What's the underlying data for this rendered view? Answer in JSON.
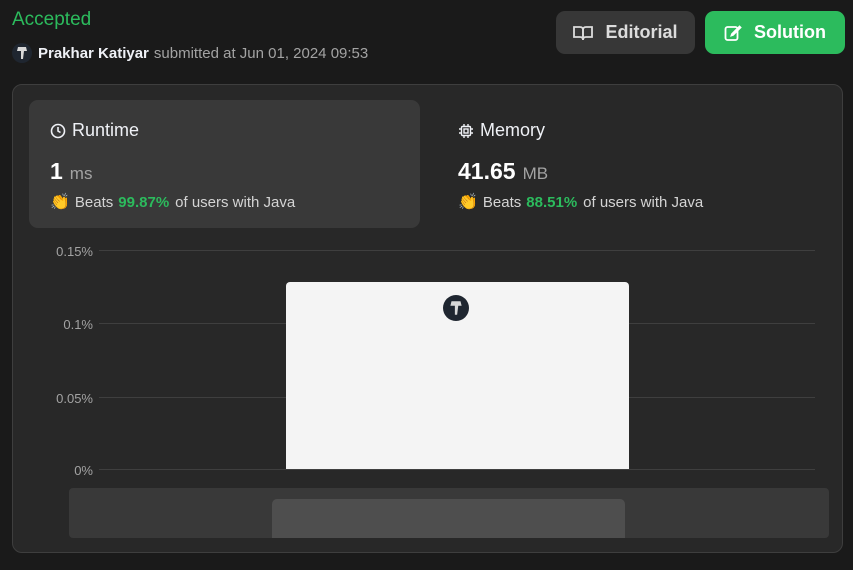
{
  "header": {
    "status": "Accepted",
    "submitter_name": "Prakhar Katiyar",
    "submitted_text": "submitted at Jun 01, 2024 09:53"
  },
  "buttons": {
    "editorial_label": "Editorial",
    "solution_label": "Solution"
  },
  "runtime": {
    "title": "Runtime",
    "value": "1",
    "unit": "ms",
    "beats_label": "Beats",
    "beats_pct": "99.87%",
    "beats_suffix": "of users with Java"
  },
  "memory": {
    "title": "Memory",
    "value": "41.65",
    "unit": "MB",
    "beats_label": "Beats",
    "beats_pct": "88.51%",
    "beats_suffix": "of users with Java"
  },
  "chart": {
    "y_ticks": [
      "0.15%",
      "0.1%",
      "0.05%",
      "0%"
    ]
  },
  "colors": {
    "accent_green": "#2cbb5d",
    "background": "#1a1a1a",
    "panel": "#282828"
  }
}
